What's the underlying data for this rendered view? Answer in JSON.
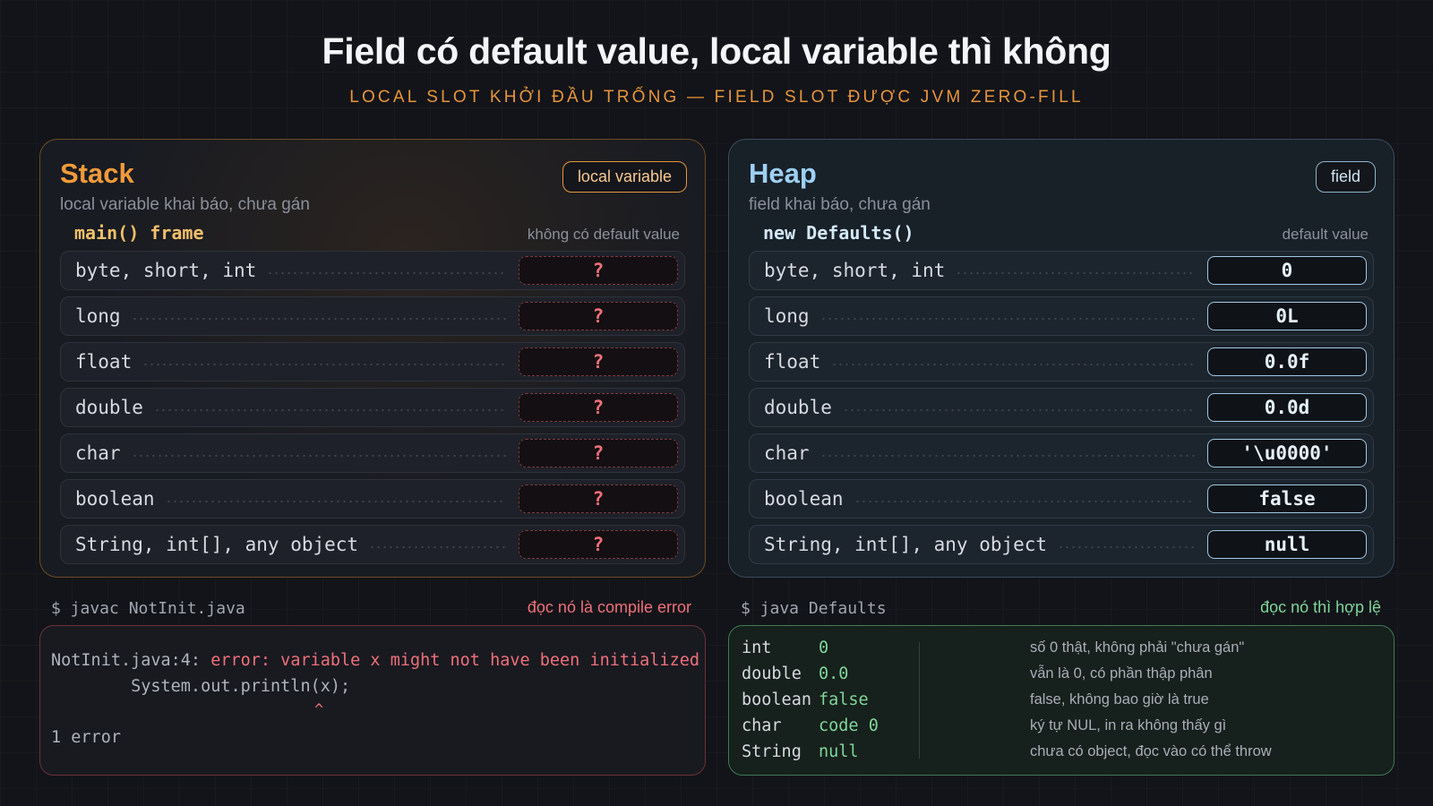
{
  "title": "Field có default value, local variable thì không",
  "subtitle": "LOCAL SLOT KHỞI ĐẦU TRỐNG — FIELD SLOT ĐƯỢC JVM ZERO-FILL",
  "stack": {
    "name": "Stack",
    "badge": "local variable",
    "description": "local variable khai báo, chưa gán",
    "frame_label": "main() frame",
    "frame_note": "không có default value",
    "rows": [
      {
        "type": "byte, short, int",
        "value": "?"
      },
      {
        "type": "long",
        "value": "?"
      },
      {
        "type": "float",
        "value": "?"
      },
      {
        "type": "double",
        "value": "?"
      },
      {
        "type": "char",
        "value": "?"
      },
      {
        "type": "boolean",
        "value": "?"
      },
      {
        "type": "String, int[], any object",
        "value": "?"
      }
    ]
  },
  "heap": {
    "name": "Heap",
    "badge": "field",
    "description": "field khai báo, chưa gán",
    "frame_label": "new Defaults()",
    "frame_note": "default value",
    "rows": [
      {
        "type": "byte, short, int",
        "value": "0"
      },
      {
        "type": "long",
        "value": "0L"
      },
      {
        "type": "float",
        "value": "0.0f"
      },
      {
        "type": "double",
        "value": "0.0d"
      },
      {
        "type": "char",
        "value": "'\\u0000'"
      },
      {
        "type": "boolean",
        "value": "false"
      },
      {
        "type": "String, int[], any object",
        "value": "null"
      }
    ]
  },
  "compile_terminal": {
    "command": "$ javac NotInit.java",
    "note": "đọc nó là compile error",
    "line1_prefix": "NotInit.java:4: ",
    "line1_error": "error: variable x might not have been initialized",
    "line2": "        System.out.println(x);",
    "caret": "^",
    "line4": "1 error"
  },
  "run_terminal": {
    "command": "$ java Defaults",
    "note": "đọc nó thì hợp lệ",
    "rows": [
      {
        "type": "int",
        "value": "0",
        "desc": "số 0 thật, không phải \"chưa gán\""
      },
      {
        "type": "double",
        "value": "0.0",
        "desc": "vẫn là 0, có phần thập phân"
      },
      {
        "type": "boolean",
        "value": "false",
        "desc": "false, không bao giờ là true"
      },
      {
        "type": "char",
        "value": "code 0",
        "desc": "ký tự NUL, in ra không thấy gì"
      },
      {
        "type": "String",
        "value": "null",
        "desc": "chưa có object, đọc vào có thể throw"
      }
    ]
  },
  "colors": {
    "accent_orange": "#f19a3a",
    "accent_blue": "#9ed0f4",
    "error_red": "#f0707a",
    "ok_green": "#7fd69a"
  }
}
